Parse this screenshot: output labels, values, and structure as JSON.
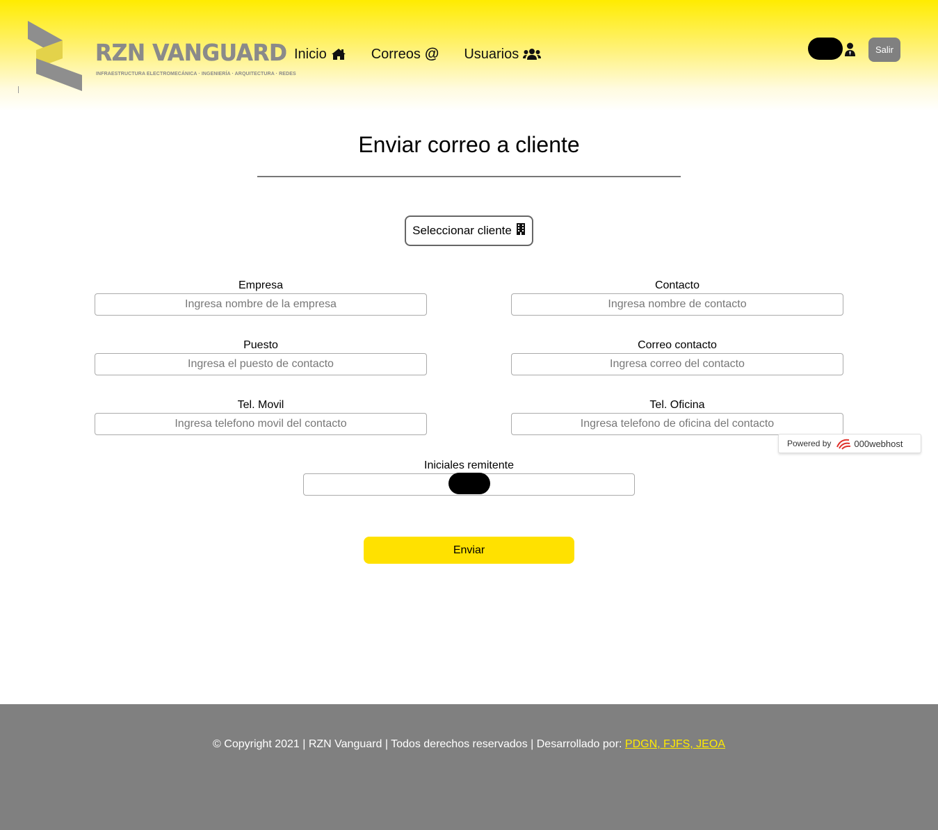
{
  "header": {
    "logo_text": "RZN VANGUARD",
    "logo_tagline": "INFRAESTRUCTURA ELECTROMECÁNICA · INGENIERÍA · ARQUITECTURA · REDES",
    "nav": [
      {
        "label": "Inicio",
        "icon": "home-icon"
      },
      {
        "label": "Correos",
        "icon": "at-icon"
      },
      {
        "label": "Usuarios",
        "icon": "users-icon"
      }
    ],
    "user_icon": "user-tie-icon",
    "logout_label": "Salir"
  },
  "main": {
    "title": "Enviar correo a cliente",
    "select_client_label": "Seleccionar cliente",
    "select_client_icon": "building-icon",
    "fields": {
      "empresa": {
        "label": "Empresa",
        "placeholder": "Ingresa nombre de la empresa",
        "value": ""
      },
      "contacto": {
        "label": "Contacto",
        "placeholder": "Ingresa nombre de contacto",
        "value": ""
      },
      "puesto": {
        "label": "Puesto",
        "placeholder": "Ingresa el puesto de contacto",
        "value": ""
      },
      "correo": {
        "label": "Correo contacto",
        "placeholder": "Ingresa correo del contacto",
        "value": ""
      },
      "movil": {
        "label": "Tel. Movil",
        "placeholder": "Ingresa telefono movil del contacto",
        "value": ""
      },
      "oficina": {
        "label": "Tel. Oficina",
        "placeholder": "Ingresa telefono de oficina del contacto",
        "value": ""
      },
      "iniciales": {
        "label": "Iniciales remitente",
        "placeholder": "",
        "value": ""
      }
    },
    "submit_label": "Enviar"
  },
  "powered": {
    "prefix": "Powered by",
    "brand": "000webhost"
  },
  "footer": {
    "text": "© Copyright 2021 | RZN Vanguard | Todos derechos reservados | Desarrollado por:",
    "link": "PDGN, FJFS, JEOA"
  },
  "colors": {
    "accent_yellow": "#ffe100",
    "footer_gray": "#808080",
    "link_yellow": "#ffeb00"
  }
}
